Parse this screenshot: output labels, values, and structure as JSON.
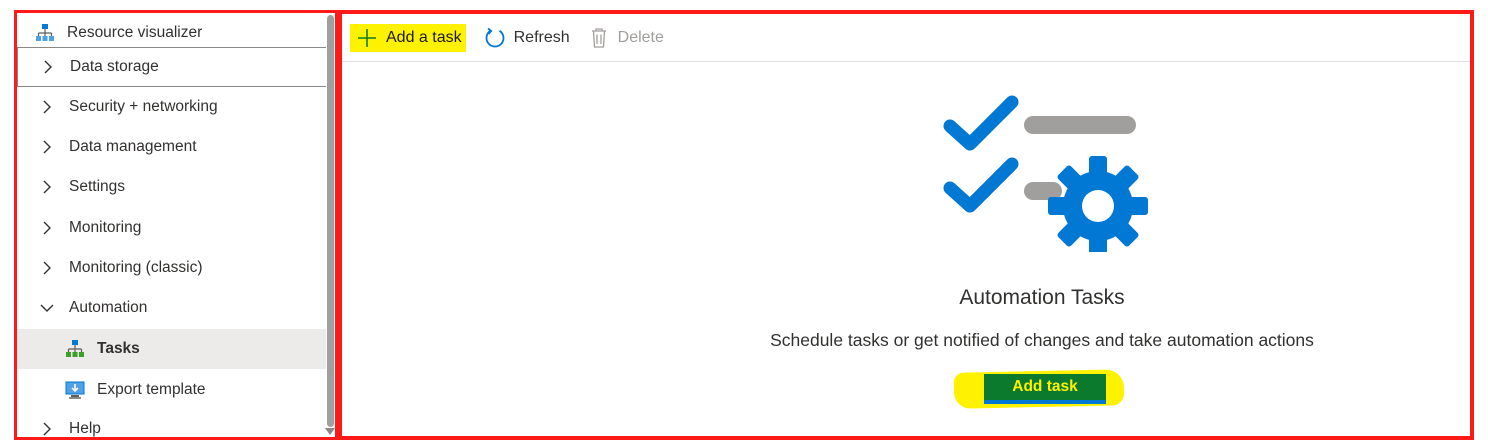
{
  "sidebar": {
    "items": [
      {
        "label": "Resource visualizer",
        "kind": "top",
        "icon": "resource-visualizer-icon"
      },
      {
        "label": "Data storage",
        "kind": "group",
        "expanded": false
      },
      {
        "label": "Security + networking",
        "kind": "group",
        "expanded": false
      },
      {
        "label": "Data management",
        "kind": "group",
        "expanded": false
      },
      {
        "label": "Settings",
        "kind": "group",
        "expanded": false
      },
      {
        "label": "Monitoring",
        "kind": "group",
        "expanded": false
      },
      {
        "label": "Monitoring (classic)",
        "kind": "group",
        "expanded": false
      },
      {
        "label": "Automation",
        "kind": "group",
        "expanded": true
      },
      {
        "label": "Tasks",
        "kind": "child",
        "icon": "tasks-icon",
        "selected": true
      },
      {
        "label": "Export template",
        "kind": "child",
        "icon": "export-template-icon"
      },
      {
        "label": "Help",
        "kind": "group",
        "expanded": false
      }
    ]
  },
  "toolbar": {
    "add_label": "Add a task",
    "refresh_label": "Refresh",
    "delete_label": "Delete"
  },
  "empty_state": {
    "title": "Automation Tasks",
    "description": "Schedule tasks or get notified of changes and take automation actions",
    "button_label": "Add task",
    "illustration": "automation-tasks-illustration"
  },
  "colors": {
    "highlight": "#fff200",
    "accent_blue": "#0078d4",
    "button_green": "#0b7a2c",
    "annotation_red": "#ff1a1a"
  }
}
